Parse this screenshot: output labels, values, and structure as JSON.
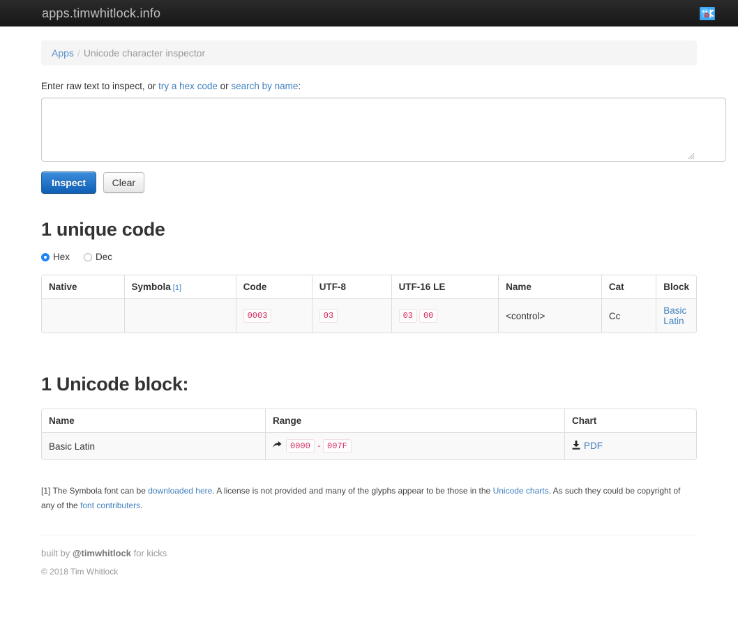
{
  "navbar": {
    "brand": "apps.timwhitlock.info",
    "icon": "twitter-bird-icon"
  },
  "breadcrumb": {
    "home": "Apps",
    "divider": "/",
    "current": "Unicode character inspector"
  },
  "form": {
    "intro_prefix": "Enter raw text to inspect, or ",
    "link_hex": "try a hex code",
    "intro_mid": " or ",
    "link_name": "search by name",
    "intro_suffix": ":",
    "textarea_value": "",
    "textarea_placeholder": "",
    "inspect_label": "Inspect",
    "clear_label": "Clear"
  },
  "codes_section": {
    "heading": "1 unique code",
    "radios": [
      {
        "label": "Hex",
        "checked": true
      },
      {
        "label": "Dec",
        "checked": false
      }
    ],
    "columns": [
      "Native",
      "Symbola",
      "Code",
      "UTF-8",
      "UTF-16 LE",
      "Name",
      "Cat",
      "Block"
    ],
    "symbola_footnote_ref": "[1]",
    "rows": [
      {
        "native": "",
        "symbola": "",
        "code": "0003",
        "utf8": [
          "03"
        ],
        "utf16le": [
          "03",
          "00"
        ],
        "name": "<control>",
        "cat": "Cc",
        "block": "Basic Latin"
      }
    ]
  },
  "blocks_section": {
    "heading": "1 Unicode block:",
    "columns": [
      "Name",
      "Range",
      "Chart"
    ],
    "rows": [
      {
        "name": "Basic Latin",
        "range_icon": "arrow-icon",
        "range_start": "0000",
        "range_dash": "-",
        "range_end": "007F",
        "chart_icon": "download-icon",
        "chart_link": "PDF"
      }
    ]
  },
  "footnotes": {
    "part1": "[1] The Symbola font can be ",
    "link1": "downloaded here",
    "part2": ". A license is not provided and many of the glyphs appear to be those in the ",
    "link2": "Unicode charts",
    "part3": ". As such they could be copyright of any of the ",
    "link3": "font contributers",
    "part4": "."
  },
  "footer": {
    "built_prefix": "built by ",
    "handle": "@timwhitlock",
    "built_suffix": " for kicks",
    "copyright": "© 2018 Tim Whitlock"
  },
  "colors": {
    "navbar_bg": "#1c1c1c",
    "link": "#3f7fbf",
    "primary_button": "#0e5fb5",
    "code_red": "#d6285a",
    "radio_blue": "#1f84f5"
  }
}
